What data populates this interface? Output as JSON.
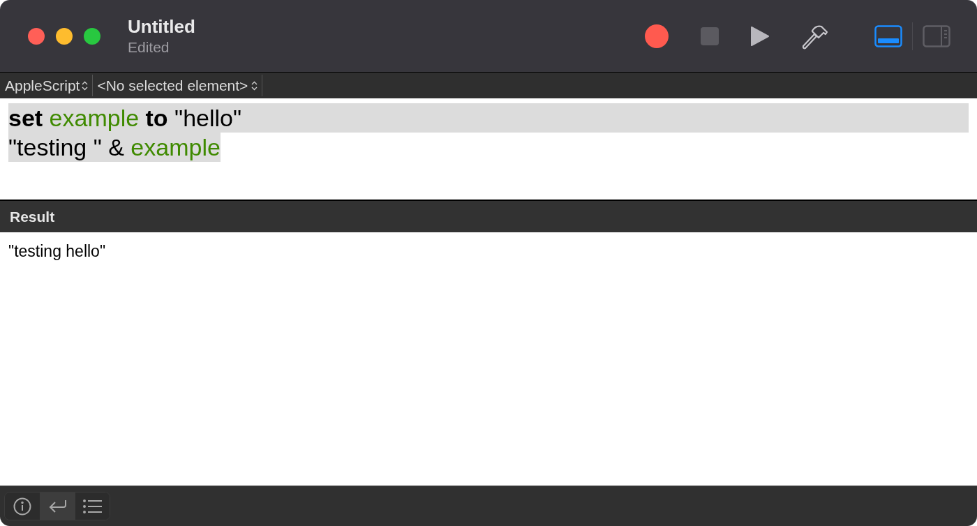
{
  "window": {
    "title": "Untitled",
    "subtitle": "Edited"
  },
  "toolbar": [
    {
      "kind": "record"
    },
    {
      "kind": "stop"
    },
    {
      "kind": "run"
    },
    {
      "kind": "compile"
    }
  ],
  "view_toggles": [
    {
      "kind": "bottom",
      "selected": true
    },
    {
      "kind": "side",
      "selected": false
    }
  ],
  "navigation_bar": {
    "language": "AppleScript",
    "element": "<No selected element>"
  },
  "script": {
    "lines": [
      {
        "selected": true,
        "tokens": [
          {
            "kind": "keyword",
            "text": "set"
          },
          {
            "kind": "variable",
            "text": " example "
          },
          {
            "kind": "keyword",
            "text": "to"
          },
          {
            "kind": "plain",
            "text": " \"hello\""
          }
        ]
      },
      {
        "selected": true,
        "tokens": [
          {
            "kind": "plain",
            "text": "\"testing \" & "
          },
          {
            "kind": "variable",
            "text": "example"
          }
        ]
      }
    ]
  },
  "result": {
    "header": "Result",
    "text": "\"testing hello\""
  },
  "bottom_tabs": [
    {
      "kind": "info",
      "selected": false
    },
    {
      "kind": "return",
      "selected": true
    },
    {
      "kind": "list",
      "selected": false
    }
  ]
}
